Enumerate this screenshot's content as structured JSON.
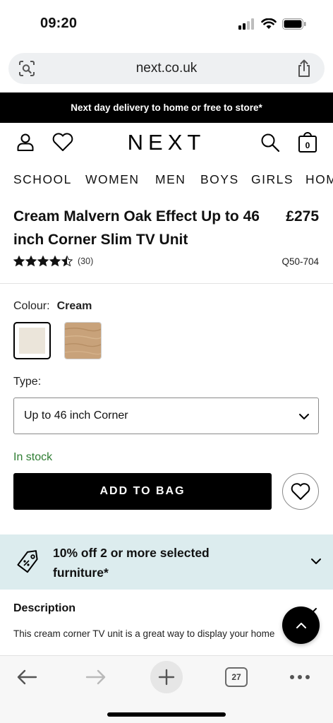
{
  "status": {
    "time": "09:20"
  },
  "browser": {
    "url": "next.co.uk",
    "tab_count": "27"
  },
  "promo_banner": "Next day delivery to home or free to store*",
  "header": {
    "logo": "NEXT",
    "bag_count": "0"
  },
  "nav": {
    "items": [
      "SCHOOL",
      "WOMEN",
      "MEN",
      "BOYS",
      "GIRLS",
      "HOME"
    ]
  },
  "product": {
    "title_line1": "Cream Malvern Oak Effect Up to 46",
    "title_line2": "inch Corner Slim TV Unit",
    "price": "£275",
    "rating": 4.5,
    "review_count": "(30)",
    "sku": "Q50-704",
    "colour_label": "Colour:",
    "colour_value": "Cream",
    "type_label": "Type:",
    "type_value": "Up to 46 inch Corner",
    "stock": "In stock",
    "add_to_bag": "ADD TO BAG"
  },
  "offer": {
    "text": "10% off 2 or more selected furniture*"
  },
  "description": {
    "title": "Description",
    "text": "This cream corner TV unit is a great way to display your home"
  },
  "colors": {
    "stock_green": "#2e7d32",
    "offer_bg": "#dcecee",
    "swatch_cream": "#ebe5da",
    "swatch_oak": "#c8a27a"
  }
}
